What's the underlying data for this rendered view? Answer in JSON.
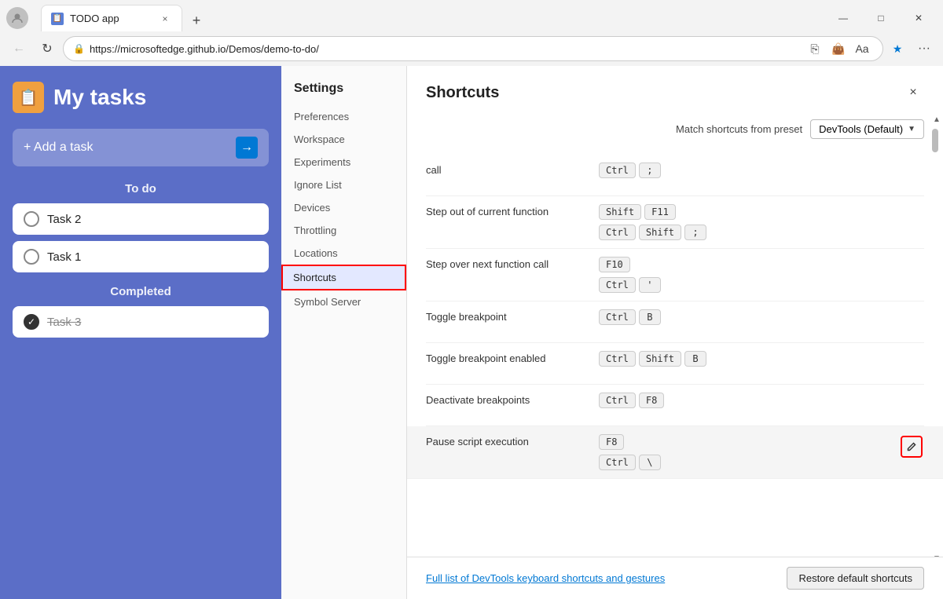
{
  "browser": {
    "profile_icon": "👤",
    "tab": {
      "favicon": "📋",
      "title": "TODO app",
      "close_label": "×"
    },
    "new_tab_label": "+",
    "window_controls": {
      "minimize": "—",
      "maximize": "□",
      "close": "✕"
    },
    "nav": {
      "back": "←",
      "refresh": "↻"
    },
    "url": "https://microsoftedge.github.io/Demos/demo-to-do/",
    "toolbar_icons": {
      "share": "↗",
      "wallet": "👜",
      "read": "Aa",
      "favorite": "★",
      "more": "···"
    }
  },
  "todo": {
    "icon": "📋",
    "title": "My tasks",
    "add_task_label": "+ Add a task",
    "add_task_arrow": "→",
    "sections": {
      "todo_label": "To do",
      "completed_label": "Completed"
    },
    "tasks": [
      {
        "id": 1,
        "name": "Task 2",
        "completed": false
      },
      {
        "id": 2,
        "name": "Task 1",
        "completed": false
      }
    ],
    "completed_tasks": [
      {
        "id": 3,
        "name": "Task 3",
        "completed": true
      }
    ]
  },
  "settings": {
    "title": "Settings",
    "items": [
      {
        "id": "preferences",
        "label": "Preferences",
        "active": false
      },
      {
        "id": "workspace",
        "label": "Workspace",
        "active": false
      },
      {
        "id": "experiments",
        "label": "Experiments",
        "active": false
      },
      {
        "id": "ignore-list",
        "label": "Ignore List",
        "active": false
      },
      {
        "id": "devices",
        "label": "Devices",
        "active": false
      },
      {
        "id": "throttling",
        "label": "Throttling",
        "active": false
      },
      {
        "id": "locations",
        "label": "Locations",
        "active": false
      },
      {
        "id": "shortcuts",
        "label": "Shortcuts",
        "active": true
      },
      {
        "id": "symbol-server",
        "label": "Symbol Server",
        "active": false
      }
    ]
  },
  "shortcuts": {
    "title": "Shortcuts",
    "preset_label": "Match shortcuts from preset",
    "preset_value": "DevTools (Default)",
    "close_label": "×",
    "rows": [
      {
        "id": "call",
        "name": "call",
        "keys": [
          [
            "Ctrl",
            ";"
          ]
        ]
      },
      {
        "id": "step-out",
        "name": "Step out of current function",
        "keys": [
          [
            "Shift",
            "F11"
          ],
          [
            "Ctrl",
            "Shift",
            ";"
          ]
        ]
      },
      {
        "id": "step-over",
        "name": "Step over next function call",
        "keys": [
          [
            "F10"
          ],
          [
            "Ctrl",
            "'"
          ]
        ]
      },
      {
        "id": "toggle-breakpoint",
        "name": "Toggle breakpoint",
        "keys": [
          [
            "Ctrl",
            "B"
          ]
        ]
      },
      {
        "id": "toggle-breakpoint-enabled",
        "name": "Toggle breakpoint enabled",
        "keys": [
          [
            "Ctrl",
            "Shift",
            "B"
          ]
        ]
      },
      {
        "id": "deactivate-breakpoints",
        "name": "Deactivate breakpoints",
        "keys": [
          [
            "Ctrl",
            "F8"
          ]
        ]
      },
      {
        "id": "pause-script",
        "name": "Pause script execution",
        "highlighted": true,
        "keys": [
          [
            "F8"
          ],
          [
            "Ctrl",
            "\\"
          ]
        ],
        "has_edit": true
      }
    ],
    "footer": {
      "link_text": "Full list of DevTools keyboard shortcuts and gestures",
      "restore_label": "Restore default shortcuts"
    },
    "scroll_up": "▲",
    "scroll_down": "▼"
  }
}
